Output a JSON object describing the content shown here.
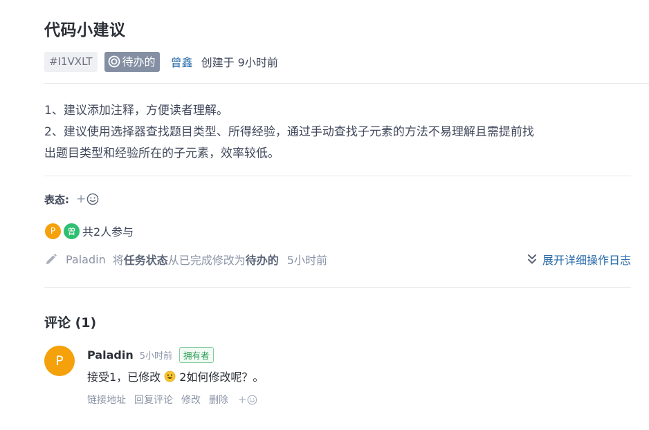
{
  "issue": {
    "title": "代码小建议",
    "id": "#I1VXLT",
    "status": "待办的",
    "author": "曾鑫",
    "created": "创建于 9小时前"
  },
  "description": {
    "lines": [
      "1、建议添加注释，方便读者理解。",
      "2、建议使用选择器查找题目类型、所得经验，通过手动查找子元素的方法不易理解且需提前找",
      "出题目类型和经验所在的子元素，效率较低。"
    ]
  },
  "reactions": {
    "label": "表态:",
    "add_plus": "+",
    "add_icon": "smiley-icon"
  },
  "participants": {
    "avatars": [
      {
        "initial": "P",
        "color": "#f5a10b"
      },
      {
        "initial": "曾",
        "color": "#2fbf71"
      }
    ],
    "count_text": "共2人参与"
  },
  "activity": {
    "icon": "pencil-icon",
    "actor": "Paladin",
    "pre": "将",
    "field": "任务状态",
    "mid": "从已完成修改为",
    "value": "待办的",
    "time": "5小时前",
    "expand_label": "展开详细操作日志",
    "expand_icon": "double-chevron-down-icon"
  },
  "comments": {
    "title": "评论 (1)",
    "items": [
      {
        "avatar_initial": "P",
        "author": "Paladin",
        "time": "5小时前",
        "badge": "拥有者",
        "text_before": "接受1，已修改",
        "emoji": "smiley-emoji",
        "text_after": "2如何修改呢？。",
        "actions": [
          "链接地址",
          "回复评论",
          "修改",
          "删除"
        ],
        "add_plus": "+"
      }
    ]
  },
  "colors": {
    "link": "#2a6baa",
    "status_bg": "#848fa3",
    "avatar_orange": "#f5a10b",
    "avatar_green": "#2fbf71",
    "owner_green": "#2f9d57"
  }
}
